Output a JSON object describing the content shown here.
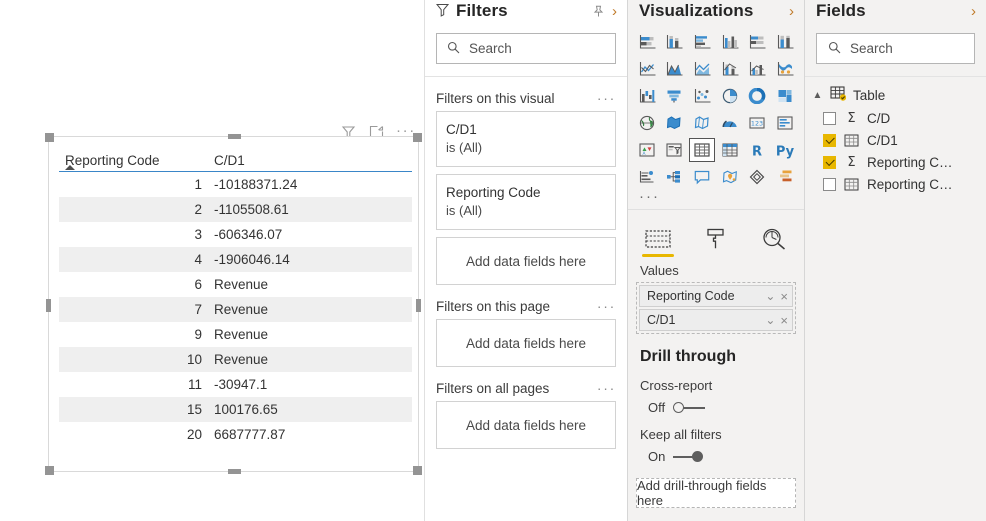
{
  "canvas": {
    "visual_header": {
      "filter_icon": "filter-icon",
      "focus_icon": "focus-mode-icon",
      "more_label": "···"
    },
    "table_visual": {
      "columns": [
        "Reporting Code",
        "C/D1"
      ],
      "sort_column": "Reporting Code",
      "sort_direction": "ascending",
      "header_underline_color": "#3a86c8",
      "rows": [
        {
          "code": "1",
          "value": "-10188371.24"
        },
        {
          "code": "2",
          "value": "-1105508.61"
        },
        {
          "code": "3",
          "value": "-606346.07"
        },
        {
          "code": "4",
          "value": "-1906046.14"
        },
        {
          "code": "6",
          "value": "Revenue"
        },
        {
          "code": "7",
          "value": "Revenue"
        },
        {
          "code": "9",
          "value": "Revenue"
        },
        {
          "code": "10",
          "value": "Revenue"
        },
        {
          "code": "11",
          "value": "-30947.1"
        },
        {
          "code": "15",
          "value": "100176.65"
        },
        {
          "code": "20",
          "value": "6687777.87"
        }
      ]
    }
  },
  "filters": {
    "title": "Filters",
    "search_placeholder": "Search",
    "sections": [
      {
        "title": "Filters on this visual",
        "more_label": "···",
        "cards": [
          {
            "name": "C/D1",
            "state": "is (All)"
          },
          {
            "name": "Reporting Code",
            "state": "is (All)"
          }
        ],
        "dropzone": "Add data fields here"
      },
      {
        "title": "Filters on this page",
        "more_label": "···",
        "cards": [],
        "dropzone": "Add data fields here"
      },
      {
        "title": "Filters on all pages",
        "more_label": "···",
        "cards": [],
        "dropzone": "Add data fields here"
      }
    ]
  },
  "visualizations": {
    "title": "Visualizations",
    "selected_visual": "table",
    "icons": [
      "stacked-bar-chart-icon",
      "stacked-column-chart-icon",
      "clustered-bar-chart-icon",
      "clustered-column-chart-icon",
      "100-stacked-bar-chart-icon",
      "100-stacked-column-chart-icon",
      "line-chart-icon",
      "area-chart-icon",
      "stacked-area-chart-icon",
      "line-stacked-column-chart-icon",
      "line-clustered-column-chart-icon",
      "ribbon-chart-icon",
      "waterfall-chart-icon",
      "funnel-chart-icon",
      "scatter-chart-icon",
      "pie-chart-icon",
      "donut-chart-icon",
      "treemap-icon",
      "map-icon",
      "filled-map-icon",
      "shape-map-icon",
      "gauge-icon",
      "card-icon",
      "multi-row-card-icon",
      "kpi-icon",
      "slicer-icon",
      "table-icon",
      "matrix-icon",
      "r-script-visual-icon",
      "python-visual-icon",
      "key-influencers-icon",
      "decomposition-tree-icon",
      "q-and-a-icon",
      "arcgis-map-icon",
      "power-apps-icon",
      "paginated-report-icon"
    ],
    "more_label": "···",
    "tabs": [
      {
        "name": "fields",
        "icon": "fields-pane-icon",
        "active": true
      },
      {
        "name": "format",
        "icon": "paint-roller-icon",
        "active": false
      },
      {
        "name": "analytics",
        "icon": "magnifier-chart-icon",
        "active": false
      }
    ],
    "well": {
      "label": "Values",
      "chips": [
        {
          "name": "Reporting Code",
          "chevron": "chevron-down-icon",
          "remove": "×"
        },
        {
          "name": "C/D1",
          "chevron": "chevron-down-icon",
          "remove": "×"
        }
      ]
    },
    "drill_through": {
      "title": "Drill through",
      "cross_report": {
        "label": "Cross-report",
        "state": "Off",
        "on": false
      },
      "keep_all_filters": {
        "label": "Keep all filters",
        "state": "On",
        "on": true
      },
      "dropzone": "Add drill-through fields here"
    }
  },
  "fields": {
    "title": "Fields",
    "search_placeholder": "Search",
    "table": {
      "name": "Table",
      "expanded": true,
      "caret": "chevron-up-icon"
    },
    "items": [
      {
        "label": "C/D",
        "checked": false,
        "icon": "sigma-icon",
        "glyph": "Σ"
      },
      {
        "label": "C/D1",
        "checked": true,
        "icon": "measure-icon",
        "glyph": ""
      },
      {
        "label": "Reporting C…",
        "checked": true,
        "icon": "sigma-icon",
        "glyph": "Σ"
      },
      {
        "label": "Reporting C…",
        "checked": false,
        "icon": "measure-icon",
        "glyph": ""
      }
    ]
  },
  "colors": {
    "accent_yellow": "#e8b700",
    "header_underline": "#3a86c8",
    "panel_bg": "#f3f2f1",
    "row_stripe": "#efefef",
    "chevron_orange": "#c07b2a"
  }
}
